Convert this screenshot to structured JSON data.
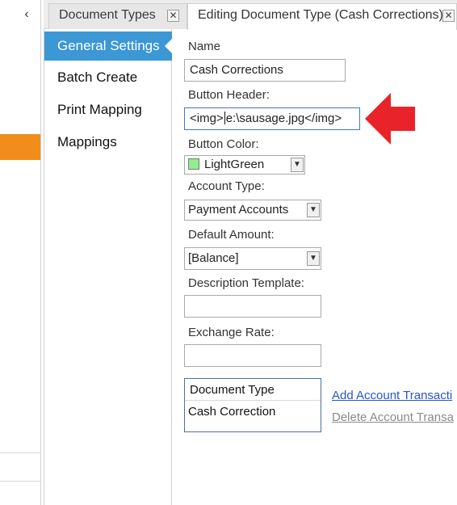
{
  "left_strip": {
    "collapse_glyph": "‹"
  },
  "tabs": [
    {
      "label": "Document Types",
      "close_glyph": "✕"
    },
    {
      "label": "Editing Document Type (Cash Corrections)",
      "close_glyph": "✕"
    }
  ],
  "nav": {
    "items": [
      {
        "label": "General Settings"
      },
      {
        "label": "Batch Create"
      },
      {
        "label": "Print Mapping"
      },
      {
        "label": "Mappings"
      }
    ]
  },
  "form": {
    "name": {
      "label": "Name",
      "value": "Cash Corrections"
    },
    "button_header": {
      "label": "Button Header:",
      "value_before_caret": "<img>",
      "value_after_caret": "e:\\sausage.jpg</img>"
    },
    "button_color": {
      "label": "Button Color:",
      "value": "LightGreen",
      "swatch_color": "#90ee90"
    },
    "account_type": {
      "label": "Account Type:",
      "value": "Payment Accounts"
    },
    "default_amount": {
      "label": "Default Amount:",
      "value": "[Balance]"
    },
    "description_template": {
      "label": "Description Template:",
      "value": ""
    },
    "exchange_rate": {
      "label": "Exchange Rate:",
      "value": ""
    },
    "grid": {
      "header": "Document Type",
      "rows": [
        "Cash Correction"
      ]
    },
    "links": {
      "add": "Add Account Transacti",
      "delete": "Delete Account Transa"
    }
  },
  "annotation": {
    "arrow_color": "#e8242a"
  },
  "colors": {
    "active_nav": "#3c97d5",
    "orange_marker": "#f28c1a"
  }
}
